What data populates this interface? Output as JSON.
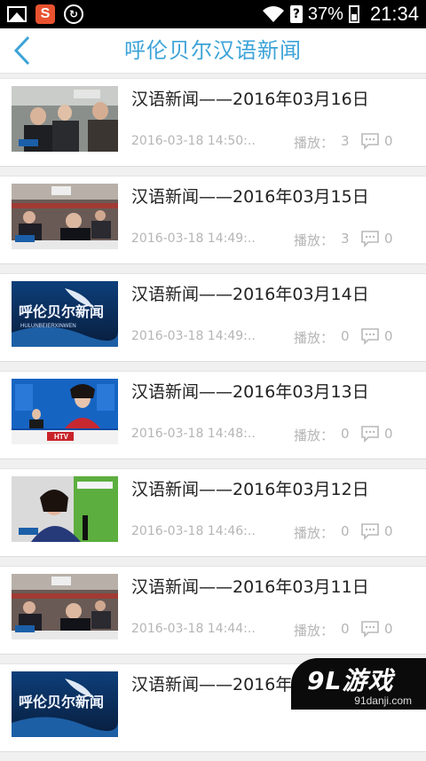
{
  "status_bar": {
    "battery": "37%",
    "time": "21:34",
    "icons": [
      "image-icon",
      "sogou-icon",
      "sync-icon",
      "wifi-icon",
      "no-sim-icon",
      "battery-icon"
    ]
  },
  "header": {
    "title": "呼伦贝尔汉语新闻",
    "back_icon": "chevron-left-icon",
    "accent_color": "#3ca3d8"
  },
  "list": {
    "play_label": "播放：",
    "items": [
      {
        "title": "汉语新闻——2016年03月16日",
        "date": "2016-03-18 14:50:..",
        "plays": "3",
        "comments": "0",
        "thumb": "meeting-people"
      },
      {
        "title": "汉语新闻——2016年03月15日",
        "date": "2016-03-18 14:49:..",
        "plays": "3",
        "comments": "0",
        "thumb": "conference-hall"
      },
      {
        "title": "汉语新闻——2016年03月14日",
        "date": "2016-03-18 14:49:..",
        "plays": "0",
        "comments": "0",
        "thumb": "news-logo",
        "thumb_text": "呼伦贝尔新闻",
        "thumb_sub": "HULUNBEIERXINWEN"
      },
      {
        "title": "汉语新闻——2016年03月13日",
        "date": "2016-03-18 14:48:..",
        "plays": "0",
        "comments": "0",
        "thumb": "news-anchor",
        "thumb_text": "HTV"
      },
      {
        "title": "汉语新闻——2016年03月12日",
        "date": "2016-03-18 14:46:..",
        "plays": "0",
        "comments": "0",
        "thumb": "interview"
      },
      {
        "title": "汉语新闻——2016年03月11日",
        "date": "2016-03-18 14:44:..",
        "plays": "0",
        "comments": "0",
        "thumb": "conference-hall"
      },
      {
        "title": "汉语新闻——2016年03月10日",
        "date": "",
        "plays": "",
        "comments": "",
        "thumb": "news-logo",
        "thumb_text": "呼伦贝尔新闻"
      }
    ]
  },
  "watermark": {
    "main": "9L游戏",
    "sub": "91danji.com"
  }
}
